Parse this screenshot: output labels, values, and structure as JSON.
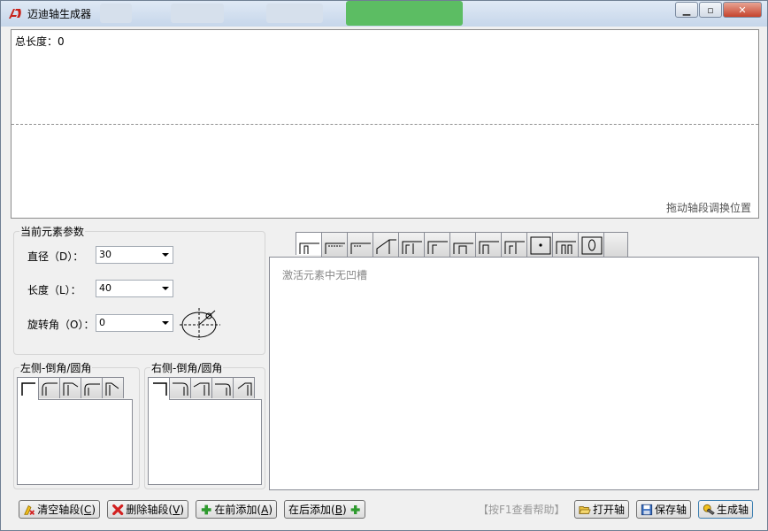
{
  "window": {
    "title": "迈迪轴生成器"
  },
  "canvas": {
    "total_length_label": "总长度：",
    "total_length_value": "0",
    "drag_hint": "拖动轴段调换位置"
  },
  "params": {
    "legend": "当前元素参数",
    "diameter": {
      "label": "直径（D）：",
      "value": "30"
    },
    "length": {
      "label": "长度（L）：",
      "value": "40"
    },
    "rotation": {
      "label": "旋转角（O）：",
      "value": "0"
    }
  },
  "left_chamfer": {
    "legend": "左侧-倒角/圆角"
  },
  "right_chamfer": {
    "legend": "右侧-倒角/圆角"
  },
  "groove_pane": {
    "message": "激活元素中无凹槽"
  },
  "bottom": {
    "clear_label": "清空轴段",
    "clear_key": "C",
    "delete_label": "删除轴段",
    "delete_key": "V",
    "add_before_label": "在前添加",
    "add_before_key": "A",
    "add_after_label": "在后添加",
    "add_after_key": "B",
    "help_text": "【按F1查看帮助】",
    "open_label": "打开轴",
    "save_label": "保存轴",
    "generate_label": "生成轴"
  },
  "colors": {
    "accent": "#2e9a2e",
    "delete_red": "#d22020"
  }
}
